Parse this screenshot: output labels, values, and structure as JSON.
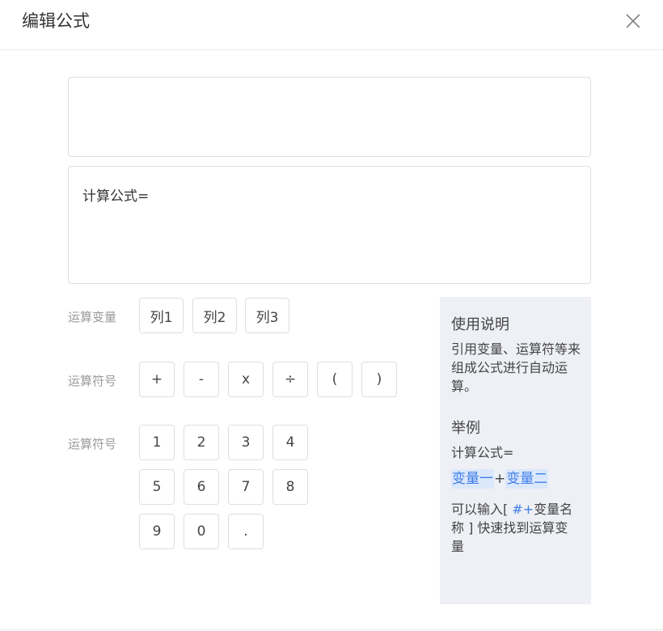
{
  "dialog": {
    "title": "编辑公式",
    "close_icon": "close-icon"
  },
  "editor": {
    "top_box_value": "",
    "formula_text": "计算公式="
  },
  "variables": {
    "label": "运算变量",
    "items": [
      "列1",
      "列2",
      "列3"
    ]
  },
  "operators": {
    "label": "运算符号",
    "items": [
      "+",
      "-",
      "x",
      "÷",
      "(",
      ")"
    ]
  },
  "numbers": {
    "label": "运算符号",
    "items": [
      "1",
      "2",
      "3",
      "4",
      "5",
      "6",
      "7",
      "8",
      "9",
      "0",
      "."
    ]
  },
  "help": {
    "usage_title": "使用说明",
    "usage_text": "引用变量、运算符等来组成公式进行自动运算。",
    "example_title": "举例",
    "example_formula": "计算公式=",
    "example_var1": "变量一",
    "example_plus": "+",
    "example_var2": "变量二",
    "tip_prefix": "可以输入[ ",
    "tip_key": "#+",
    "tip_suffix": "变量名称 ] 快速找到运算变量"
  },
  "colors": {
    "accent": "#3e7ee8",
    "chip_bg": "#dbe8fb",
    "panel_bg": "#eef0f5",
    "border": "#dcdfe6"
  }
}
